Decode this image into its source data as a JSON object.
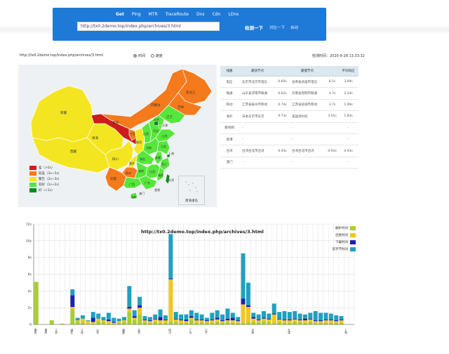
{
  "nav": {
    "tabs": [
      "Get",
      "Ping",
      "MTR",
      "TraceRoute",
      "Dns",
      "Cdn",
      "LDns"
    ],
    "url_value": "http://tx0.2demo.top/index.php/archives/3.html",
    "check_button": "检测一下",
    "link_history": "对比一下",
    "link_auto": "自动"
  },
  "info": {
    "url": "http://tx0.2demo.top/index.php/archives/3.html",
    "radio_time": "时间",
    "radio_speed": "速度",
    "checked_at": "检测时间：2020-9-28 13:33:32"
  },
  "map": {
    "provinces": [
      "黑龙江",
      "吉林",
      "辽宁",
      "内蒙古",
      "新疆",
      "西藏",
      "青海",
      "甘肃",
      "宁夏",
      "陕西",
      "山西",
      "河北",
      "北京",
      "天津",
      "山东",
      "河南",
      "江苏",
      "安徽",
      "上海",
      "浙江",
      "湖北",
      "四川",
      "重庆",
      "贵州",
      "湖南",
      "江西",
      "福建",
      "云南",
      "广西",
      "广东",
      "海南",
      "台湾",
      "香港",
      "澳门"
    ],
    "legend": [
      {
        "label": "差（>5s）",
        "color": "#cc1c1c"
      },
      {
        "label": "较差（3s~5s）",
        "color": "#f57a1c"
      },
      {
        "label": "警告（2s~3s）",
        "color": "#f4e521"
      },
      {
        "label": "较好（1s~2s）",
        "color": "#57e63c"
      },
      {
        "label": "好（<1s）",
        "color": "#0c8a1e"
      }
    ],
    "inset_label": "南海诸岛"
  },
  "table": {
    "headers": [
      "线路",
      "最快节点",
      "",
      "最慢节点",
      "",
      "平均响应"
    ],
    "rows": [
      [
        "电信",
        "北京市北京市电信",
        "0.69s",
        "甘肃省武威市电信",
        "8.5s",
        "3.09s"
      ],
      [
        "联通",
        "山东省济南市联通",
        "0.62s",
        "云南省昆明市联通",
        "4.7s",
        "2.24s"
      ],
      [
        "移动",
        "江苏省泰州市移动",
        "0.74s",
        "江苏省盐城市移动",
        "3.7s",
        "1.99s"
      ],
      [
        "海外",
        "日本东京市东京",
        "0.73s",
        "美国洛杉矶",
        "3.01s",
        "1.83s"
      ],
      [
        "教育网",
        "-",
        "",
        "-",
        "",
        "-"
      ],
      [
        "香港",
        "-",
        "",
        "-",
        "",
        "-"
      ],
      [
        "台湾",
        "台湾台北市台湾",
        "0.93s",
        "台湾台北市台湾",
        "0.93s",
        "0.93s"
      ],
      [
        "澳门",
        "-",
        "",
        "-",
        "",
        "-"
      ]
    ]
  },
  "chart_data": {
    "type": "bar",
    "stacked": true,
    "title": "http://tx0.2demo.top/index.php/archives/3.html",
    "ylim": [
      0,
      12
    ],
    "ytick_labels": [
      "0",
      "2s",
      "4s",
      "6s",
      "8s",
      "10s",
      "12s"
    ],
    "categories": [
      "重庆",
      "",
      "重庆",
      "",
      "江苏",
      "",
      "",
      "湖北",
      "",
      "江苏",
      "",
      "",
      "山东",
      "",
      "",
      "",
      "",
      "福建",
      "",
      "",
      "北京",
      "",
      "",
      "",
      "",
      "",
      "四川",
      "",
      "",
      "",
      "广东",
      "",
      "",
      "辽宁",
      "",
      "",
      "",
      "",
      "",
      "",
      "",
      "",
      "吉林",
      "",
      "",
      "",
      "",
      "",
      "",
      "天津",
      "",
      "",
      "",
      "",
      "",
      "",
      "",
      "",
      "",
      "",
      "上海",
      ""
    ],
    "series": [
      {
        "name": "解析时间",
        "color": "#a8cf2a",
        "values": [
          5.1,
          0,
          0,
          0.5,
          0,
          0.1,
          0,
          1.8,
          0.4,
          0.2,
          0.1,
          0.1,
          0.4,
          0.3,
          0.1,
          0.1,
          0.2,
          0.3,
          1.5,
          0.5,
          1.2,
          0.3,
          0.2,
          0.3,
          0.2,
          0.2,
          0.4,
          0.3,
          0.2,
          0.2,
          0.5,
          0.2,
          0.3,
          0.2,
          0.2,
          0.3,
          0.2,
          0.3,
          0.2,
          0.2,
          0.2,
          0.3,
          0.3,
          0.3,
          0.4,
          0.3,
          0.2,
          0.3,
          0.2,
          0.2,
          0.3,
          0.3,
          0.2,
          0.3,
          0.2,
          0.2,
          0.2,
          0.2,
          0.2,
          0.2
        ]
      },
      {
        "name": "连接时间",
        "color": "#f3c61e",
        "values": [
          0,
          0,
          0,
          0,
          0,
          0,
          0,
          0.3,
          0.1,
          0.5,
          0.3,
          0.2,
          0.3,
          0.2,
          0.3,
          0.1,
          0.2,
          0.2,
          0.4,
          0.3,
          0.8,
          0.2,
          0.2,
          0.3,
          0.3,
          0.3,
          5.0,
          0.3,
          0.3,
          0.2,
          0.3,
          0.3,
          0.2,
          0.2,
          0.3,
          0.3,
          0.2,
          0.2,
          0.3,
          0.2,
          2.2,
          1.8,
          0.4,
          0.2,
          0.3,
          0.3,
          1.0,
          0.3,
          0.3,
          0.3,
          0.3,
          0.2,
          0.3,
          0.3,
          0.2,
          0.2,
          0.3,
          0.3,
          0.2,
          0.3
        ]
      },
      {
        "name": "下载时间",
        "color": "#1d1fb5",
        "values": [
          0,
          0,
          0,
          0,
          0,
          0,
          0,
          1.4,
          0,
          0,
          0,
          0.5,
          0,
          0,
          0.2,
          0.1,
          0,
          0,
          0.2,
          0.2,
          0.3,
          0.1,
          0.1,
          0.1,
          0.4,
          0.1,
          0.1,
          0.1,
          0.1,
          0.2,
          0.2,
          0.1,
          0.1,
          0.1,
          0.1,
          0.2,
          0.1,
          0.2,
          0.3,
          0.1,
          0.7,
          0.2,
          0.2,
          0.1,
          0.1,
          0.1,
          0.1,
          0.1,
          0.1,
          0.1,
          0.1,
          0.1,
          0.2,
          0.1,
          0.1,
          0.1,
          0.1,
          0.1,
          0.1,
          0.1
        ]
      },
      {
        "name": "首字节时间",
        "color": "#1fa0bf",
        "values": [
          0,
          0,
          0,
          0,
          0,
          0,
          0,
          0.7,
          0.3,
          0.4,
          0.1,
          0.7,
          0.6,
          0.4,
          0.8,
          0.5,
          0.3,
          0.4,
          2.5,
          0.7,
          1.0,
          0.4,
          0.4,
          0.5,
          0.9,
          0.5,
          5.3,
          0.8,
          0.6,
          0.6,
          0.7,
          0.8,
          0.6,
          0.3,
          0.8,
          0.9,
          0.7,
          1.2,
          0.6,
          0.4,
          5.4,
          2.7,
          0.5,
          0.6,
          0.8,
          0.6,
          1.2,
          0.8,
          1.0,
          0.9,
          0.9,
          0.7,
          0.5,
          0.7,
          1.1,
          0.9,
          0.8,
          0.7,
          0.6,
          0.4
        ]
      }
    ]
  }
}
